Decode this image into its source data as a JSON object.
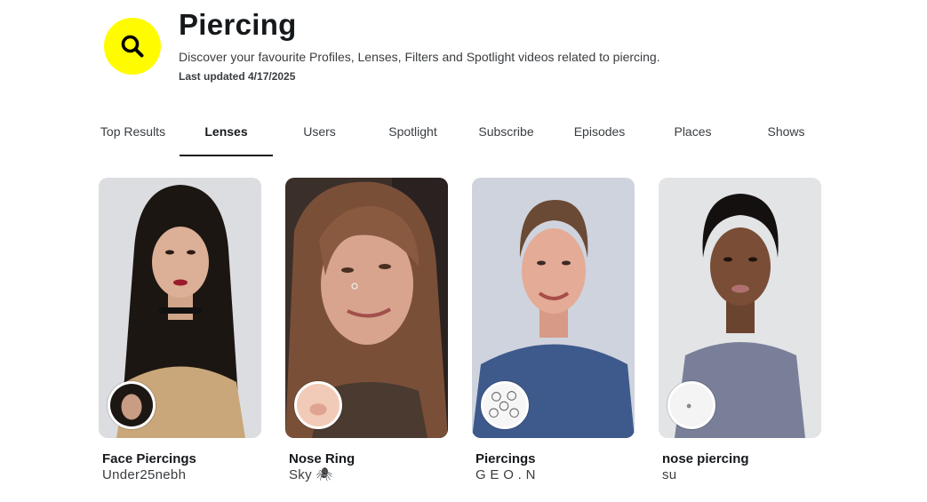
{
  "header": {
    "title": "Piercing",
    "description": "Discover your favourite Profiles, Lenses, Filters and Spotlight videos related to piercing.",
    "updated": "Last updated 4/17/2025",
    "icon": "search-icon",
    "accent": "#fffc00"
  },
  "tabs": [
    {
      "label": "Top Results",
      "active": false
    },
    {
      "label": "Lenses",
      "active": true
    },
    {
      "label": "Users",
      "active": false
    },
    {
      "label": "Spotlight",
      "active": false
    },
    {
      "label": "Subscribe",
      "active": false
    },
    {
      "label": "Episodes",
      "active": false
    },
    {
      "label": "Places",
      "active": false
    },
    {
      "label": "Shows",
      "active": false
    }
  ],
  "lenses": [
    {
      "title": "Face Piercings",
      "creator": "Under25nebh"
    },
    {
      "title": "Nose Ring",
      "creator": "Sky 🕷"
    },
    {
      "title": "Piercings",
      "creator": "G E O . N"
    },
    {
      "title": "nose piercing",
      "creator": "su"
    }
  ]
}
